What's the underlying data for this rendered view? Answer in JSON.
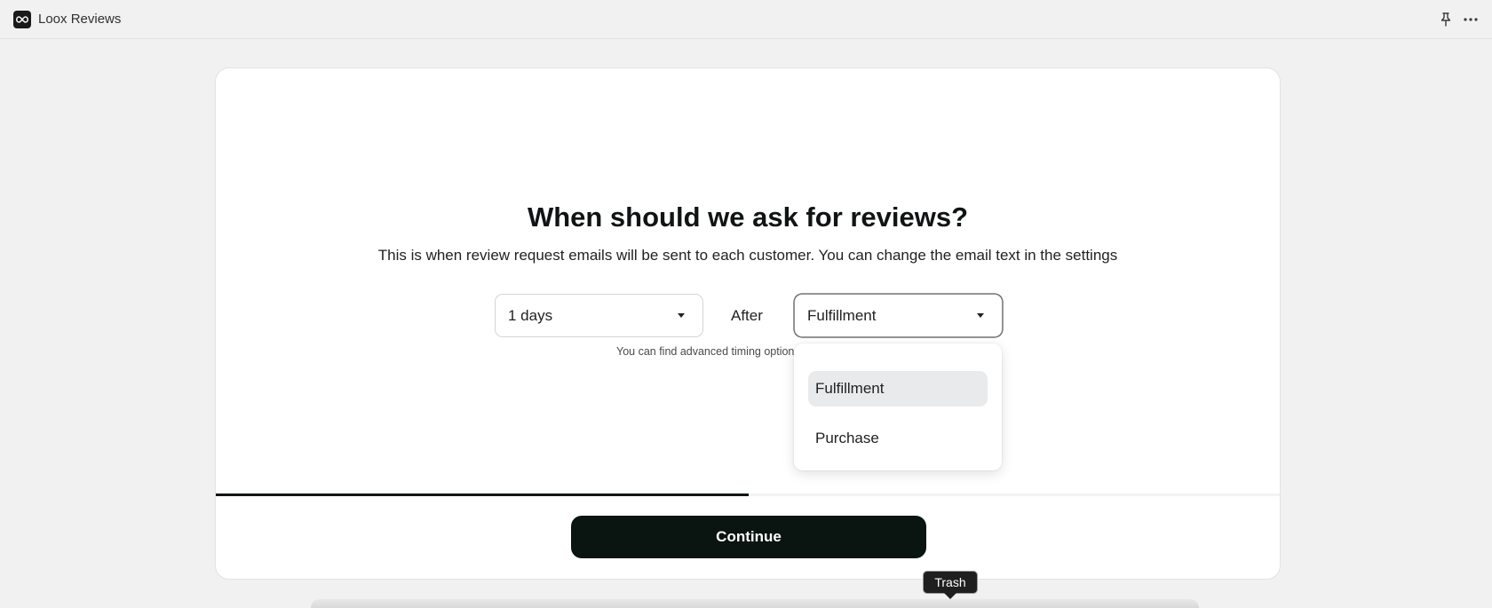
{
  "app": {
    "title": "Loox Reviews",
    "logo_icon": "infinity-icon",
    "pin_icon": "pin-icon",
    "more_icon": "more-horizontal-icon"
  },
  "onboarding": {
    "heading": "When should we ask for reviews?",
    "subheading": "This is when review request emails will be sent to each customer. You can change the email text in the settings",
    "delay_select": {
      "value": "1 days"
    },
    "after_label": "After",
    "event_select": {
      "value": "Fulfillment"
    },
    "hint": "You can find advanced timing options",
    "progress_percent": 50,
    "continue_label": "Continue"
  },
  "dropdown": {
    "options": [
      {
        "label": "Fulfillment",
        "selected": true
      },
      {
        "label": "Purchase",
        "selected": false
      }
    ]
  },
  "tooltip": {
    "label": "Trash"
  },
  "colors": {
    "primary_button": "#0a1410",
    "selected_option_bg": "#e9eaec"
  }
}
